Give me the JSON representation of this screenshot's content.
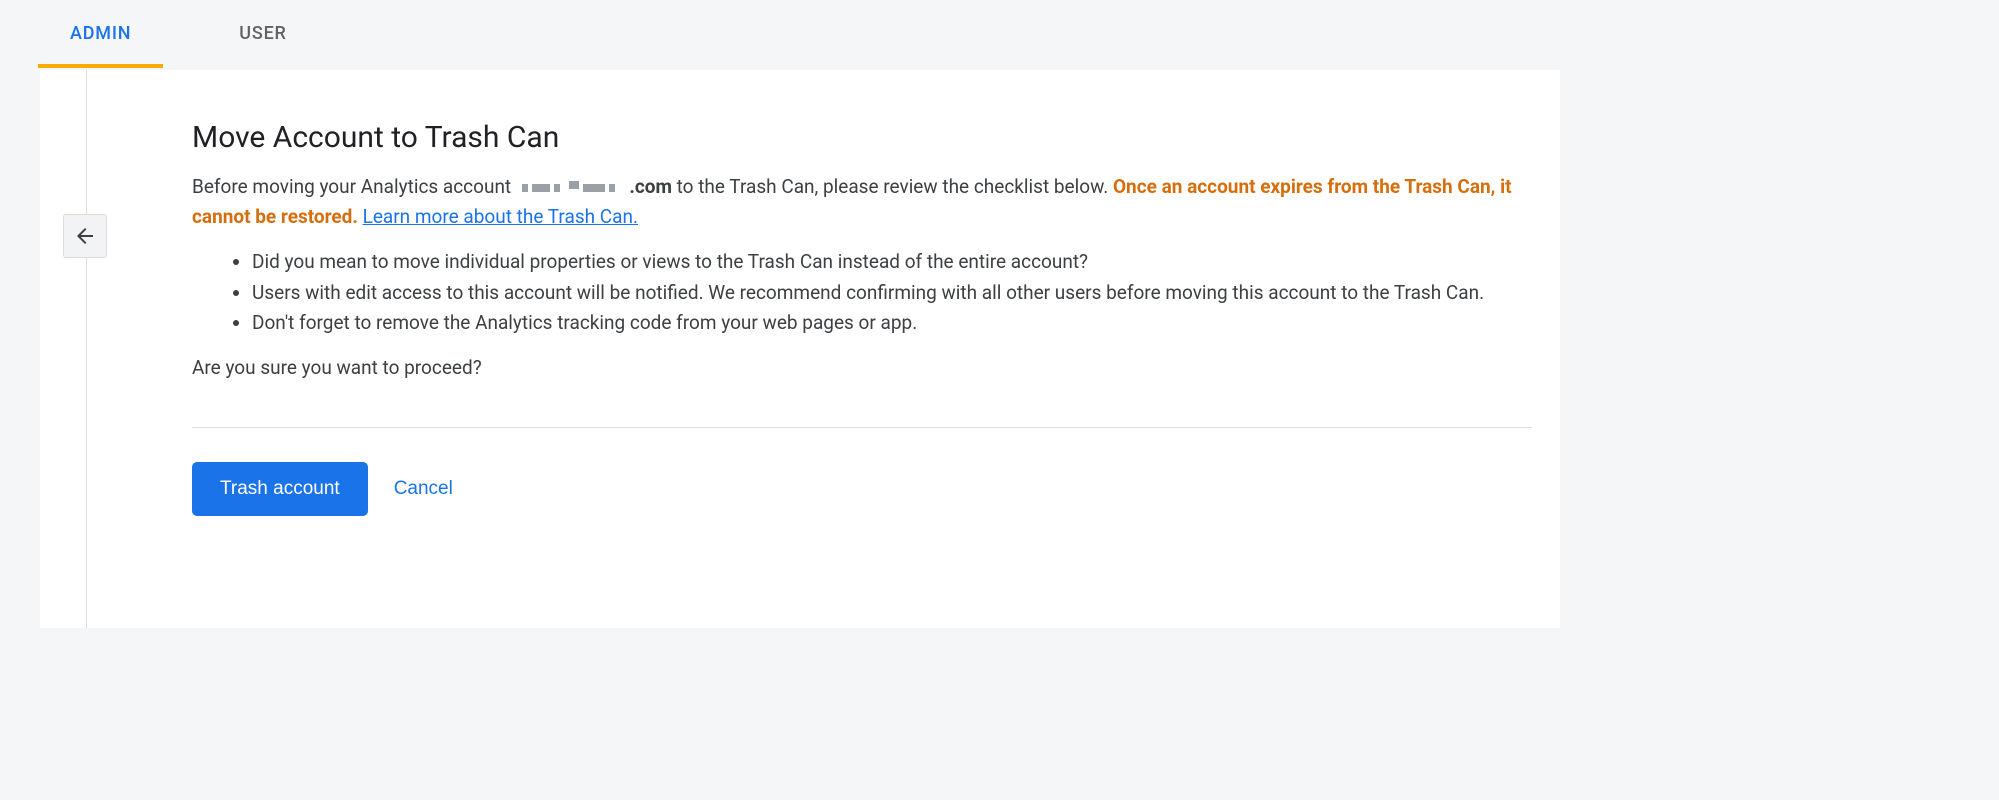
{
  "tabs": {
    "admin": "ADMIN",
    "user": "USER"
  },
  "page": {
    "title": "Move Account to Trash Can",
    "intro_before": "Before moving your Analytics account ",
    "intro_domain_suffix": ".com",
    "intro_after": " to the Trash Can, please review the checklist below. ",
    "warning": "Once an account expires from the Trash Can, it cannot be restored.",
    "learn_more": "Learn more about the Trash Can.",
    "checklist": [
      "Did you mean to move individual properties or views to the Trash Can instead of the entire account?",
      "Users with edit access to this account will be notified. We recommend confirming with all other users before moving this account to the Trash Can.",
      "Don't forget to remove the Analytics tracking code from your web pages or app."
    ],
    "confirm_question": "Are you sure you want to proceed?"
  },
  "actions": {
    "primary": "Trash account",
    "cancel": "Cancel"
  }
}
